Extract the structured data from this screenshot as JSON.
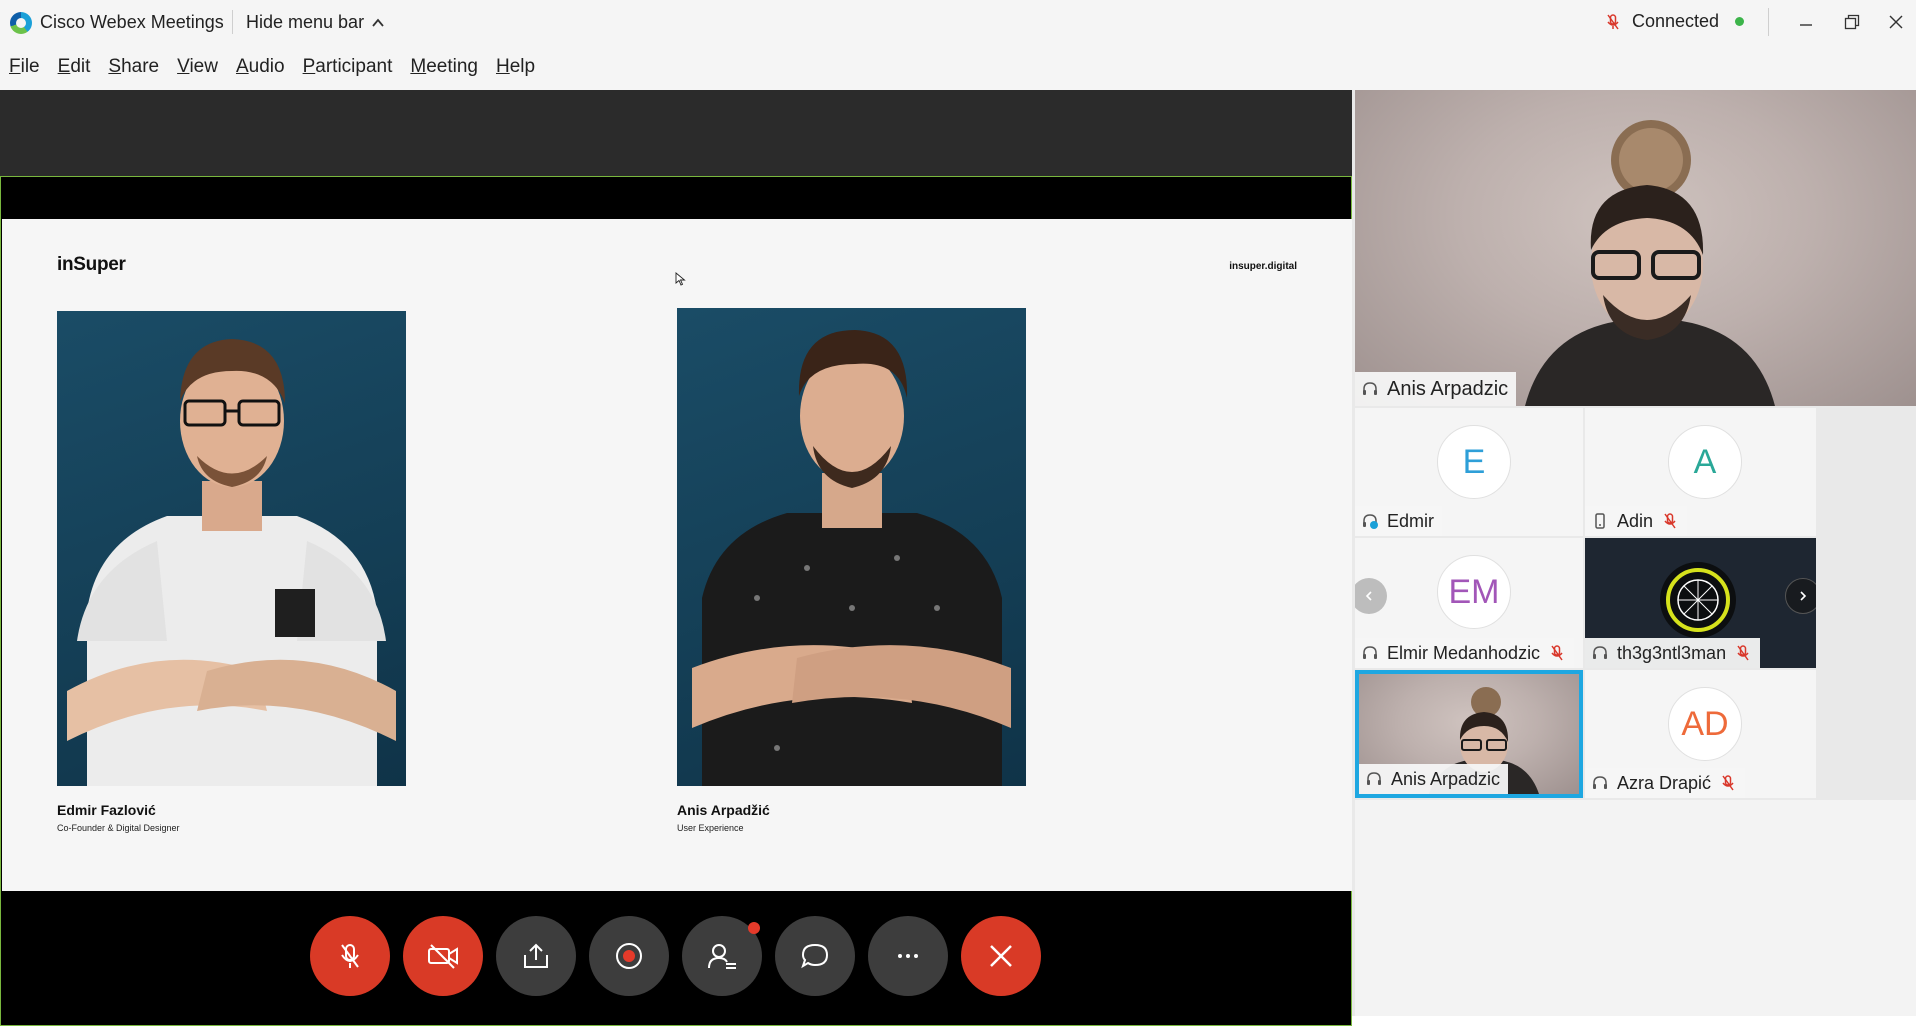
{
  "titlebar": {
    "app_title": "Cisco Webex Meetings",
    "hide_menu_label": "Hide menu bar",
    "status_label": "Connected",
    "status_color": "#3cb44a"
  },
  "menu": {
    "items": [
      {
        "mnemonic": "F",
        "rest": "ile"
      },
      {
        "mnemonic": "E",
        "rest": "dit"
      },
      {
        "mnemonic": "S",
        "rest": "hare"
      },
      {
        "mnemonic": "V",
        "rest": "iew"
      },
      {
        "mnemonic": "A",
        "rest": "udio"
      },
      {
        "mnemonic": "P",
        "rest": "articipant"
      },
      {
        "mnemonic": "M",
        "rest": "eeting"
      },
      {
        "mnemonic": "H",
        "rest": "elp"
      }
    ]
  },
  "slide": {
    "brand": "inSuper",
    "site": "insuper.digital",
    "people": [
      {
        "name": "Edmir Fazlović",
        "role": "Co-Founder & Digital Designer"
      },
      {
        "name": "Anis Arpadžić",
        "role": "User Experience"
      }
    ]
  },
  "controls": {
    "icons": [
      "mic-muted-icon",
      "video-off-icon",
      "share-icon",
      "record-icon",
      "participants-icon",
      "chat-icon",
      "more-icon",
      "end-call-icon"
    ],
    "accent_red": "#d93a26"
  },
  "participants": {
    "active_speaker": "Anis Arpadzic",
    "tiles": [
      {
        "name": "Edmir",
        "initials": "E",
        "color": "#2e9fd8"
      },
      {
        "name": "Adin",
        "initials": "A",
        "color": "#2aa898"
      },
      {
        "name": "Elmir Medanhodzic",
        "initials": "EM",
        "color": "#a256b8"
      },
      {
        "name": "th3g3ntl3man"
      },
      {
        "name": "Anis Arpadzic"
      },
      {
        "name": "Azra Drapić",
        "initials": "AD",
        "color": "#ee6a3a"
      }
    ],
    "selected_border_color": "#1ea7e1"
  }
}
